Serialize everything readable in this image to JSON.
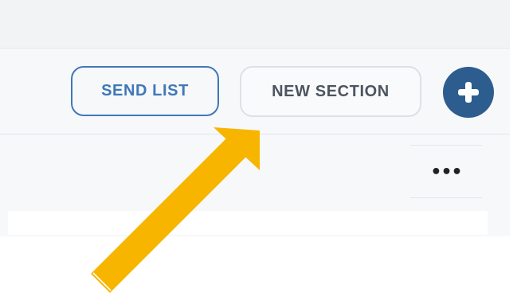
{
  "toolbar": {
    "send_list_label": "SEND LIST",
    "new_section_label": "NEW SECTION",
    "add_icon": "plus-circle-icon"
  },
  "row": {
    "more_label": "•••"
  },
  "colors": {
    "accent_blue": "#3f78b8",
    "fab_blue": "#2d5d8e",
    "arrow_yellow": "#f7b500"
  }
}
